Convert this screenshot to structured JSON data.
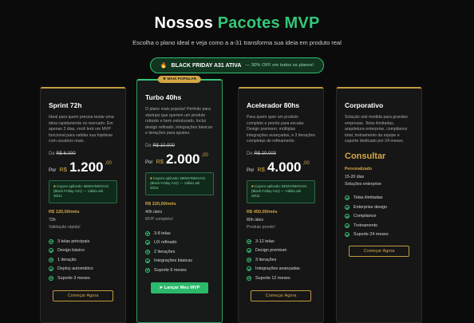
{
  "header": {
    "title_main": "Nossos ",
    "title_accent": "Pacotes MVP",
    "subtitle": "Escolha o plano ideal e veja como a a-31 transforma sua ideia em produto real",
    "promo_icon": "fire-icon",
    "promo_strong": "BLACK FRIDAY A31 ATIVA",
    "promo_weak": "— 30% OFF em todos os planos!"
  },
  "colors": {
    "accent_green": "#34c779",
    "gold": "#d4a745",
    "background": "#0b0b0b"
  },
  "plans": [
    {
      "name": "Sprint 72h",
      "description": "Ideal para quem precisa testar uma ideia rapidamente no mercado. Em apenas 3 dias, você terá um MVP funcional para validar sua hipótese com usuários reais.",
      "old_price_label": "De",
      "old_price": "R$ 6.000",
      "por": "Por",
      "currency": "R$",
      "price": "1.200",
      "cents": ",00",
      "coupon": "Cupom aplicado: BEMVINDOA31 (Black Friday A31) — Válido até 30/11",
      "monthly": "R$ 120,00/mês",
      "duration": "72h",
      "note": "Validação rápida!",
      "features": [
        "3 telas principais",
        "Design básico",
        "1 iteração",
        "Deploy automático",
        "Suporte 3 meses"
      ],
      "cta": "Começar Agora"
    },
    {
      "badge": "MAIS POPULAR",
      "name": "Turbo 40hs",
      "description": "O plano mais popular! Perfeito para startups que querem um produto robusto e bem estruturado. Inclui design refinado, integrações básicas e iterações para ajustes.",
      "old_price_label": "De",
      "old_price": "R$ 10.000",
      "por": "Por",
      "currency": "R$",
      "price": "2.000",
      "cents": ",00",
      "coupon": "Cupom aplicado: BEMVINDOA31 (Black Friday A31) — Válido até 30/11",
      "monthly": "R$ 220,00/mês",
      "duration": "40h úteis",
      "note": "MVP completo!",
      "features": [
        "3-8 telas",
        "UX refinado",
        "2 iterações",
        "Integrações básicas",
        "Suporte 6 meses"
      ],
      "cta": "Lançar Meu MVP"
    },
    {
      "name": "Acelerador 80hs",
      "description": "Para quem quer um produto completo e pronto para escalar. Design premium, múltiplas integrações avançadas, e 3 iterações completas de refinamento.",
      "old_price_label": "De",
      "old_price": "R$ 20.000",
      "por": "Por",
      "currency": "R$",
      "price": "4.000",
      "cents": ",00",
      "coupon": "Cupom aplicado: BEMVINDOA31 (Black Friday A31) — Válido até 30/11",
      "monthly": "R$ 450,00/mês",
      "duration": "80h úteis",
      "note": "Produto pronto!",
      "features": [
        "3-12 telas",
        "Design premium",
        "3 iterações",
        "Integrações avançadas",
        "Suporte 12 meses"
      ],
      "cta": "Começar Agora"
    },
    {
      "name": "Corporativo",
      "description": "Solução sob medida para grandes empresas. Telas ilimitadas, arquitetura enterprise, compliance total, treinamento da equipe e suporte dedicado por 24 meses.",
      "price_text": "Consultar",
      "personal": "Personalizado",
      "duration": "15-20 dias",
      "note": "Soluções enterprise",
      "features": [
        "Telas ilimitadas",
        "Enterprise design",
        "Compliance",
        "Treinamento",
        "Suporte 24 meses"
      ],
      "cta": "Começar Agora"
    }
  ]
}
